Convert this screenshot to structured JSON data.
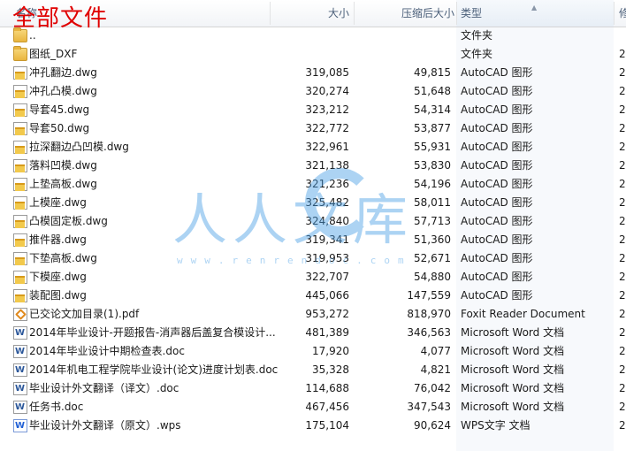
{
  "overlay_title": "全部文件",
  "columns": {
    "name": "名称",
    "size": "大小",
    "compressed": "压缩后大小",
    "type": "类型",
    "modified": "修"
  },
  "watermark": {
    "text": "人人文库",
    "url": "www.renrendoc.com"
  },
  "rows": [
    {
      "name": "..",
      "size": "",
      "comp": "",
      "type": "文件夹",
      "mod": "",
      "icon": "folder-icon"
    },
    {
      "name": "图纸_DXF",
      "size": "",
      "comp": "",
      "type": "文件夹",
      "mod": "2",
      "icon": "folder-icon"
    },
    {
      "name": "冲孔翻边.dwg",
      "size": "319,085",
      "comp": "49,815",
      "type": "AutoCAD 图形",
      "mod": "2",
      "icon": "dwg-file-icon"
    },
    {
      "name": "冲孔凸模.dwg",
      "size": "320,274",
      "comp": "51,648",
      "type": "AutoCAD 图形",
      "mod": "2",
      "icon": "dwg-file-icon"
    },
    {
      "name": "导套45.dwg",
      "size": "323,212",
      "comp": "54,314",
      "type": "AutoCAD 图形",
      "mod": "2",
      "icon": "dwg-file-icon"
    },
    {
      "name": "导套50.dwg",
      "size": "322,772",
      "comp": "53,877",
      "type": "AutoCAD 图形",
      "mod": "2",
      "icon": "dwg-file-icon"
    },
    {
      "name": "拉深翻边凸凹模.dwg",
      "size": "322,961",
      "comp": "55,931",
      "type": "AutoCAD 图形",
      "mod": "2",
      "icon": "dwg-file-icon"
    },
    {
      "name": "落料凹模.dwg",
      "size": "321,138",
      "comp": "53,830",
      "type": "AutoCAD 图形",
      "mod": "2",
      "icon": "dwg-file-icon"
    },
    {
      "name": "上垫高板.dwg",
      "size": "321,236",
      "comp": "54,196",
      "type": "AutoCAD 图形",
      "mod": "2",
      "icon": "dwg-file-icon"
    },
    {
      "name": "上模座.dwg",
      "size": "325,482",
      "comp": "58,011",
      "type": "AutoCAD 图形",
      "mod": "2",
      "icon": "dwg-file-icon"
    },
    {
      "name": "凸模固定板.dwg",
      "size": "324,840",
      "comp": "57,713",
      "type": "AutoCAD 图形",
      "mod": "2",
      "icon": "dwg-file-icon"
    },
    {
      "name": "推件器.dwg",
      "size": "319,341",
      "comp": "51,360",
      "type": "AutoCAD 图形",
      "mod": "2",
      "icon": "dwg-file-icon"
    },
    {
      "name": "下垫高板.dwg",
      "size": "319,953",
      "comp": "52,671",
      "type": "AutoCAD 图形",
      "mod": "2",
      "icon": "dwg-file-icon"
    },
    {
      "name": "下模座.dwg",
      "size": "322,707",
      "comp": "54,880",
      "type": "AutoCAD 图形",
      "mod": "2",
      "icon": "dwg-file-icon"
    },
    {
      "name": "装配图.dwg",
      "size": "445,066",
      "comp": "147,559",
      "type": "AutoCAD 图形",
      "mod": "2",
      "icon": "dwg-file-icon"
    },
    {
      "name": "已交论文加目录(1).pdf",
      "size": "953,272",
      "comp": "818,970",
      "type": "Foxit Reader Document",
      "mod": "2",
      "icon": "pdf-file-icon"
    },
    {
      "name": "2014年毕业设计-开题报告-消声器后盖复合模设计...",
      "size": "481,389",
      "comp": "346,563",
      "type": "Microsoft Word 文档",
      "mod": "2",
      "icon": "word-doc-icon"
    },
    {
      "name": "2014年毕业设计中期检查表.doc",
      "size": "17,920",
      "comp": "4,077",
      "type": "Microsoft Word 文档",
      "mod": "2",
      "icon": "word-doc-icon"
    },
    {
      "name": "2014年机电工程学院毕业设计(论文)进度计划表.doc",
      "size": "35,328",
      "comp": "4,821",
      "type": "Microsoft Word 文档",
      "mod": "2",
      "icon": "word-doc-icon"
    },
    {
      "name": "毕业设计外文翻译（译文）.doc",
      "size": "114,688",
      "comp": "76,042",
      "type": "Microsoft Word 文档",
      "mod": "2",
      "icon": "word-doc-icon"
    },
    {
      "name": "任务书.doc",
      "size": "467,456",
      "comp": "347,543",
      "type": "Microsoft Word 文档",
      "mod": "2",
      "icon": "word-doc-icon"
    },
    {
      "name": "毕业设计外文翻译（原文）.wps",
      "size": "175,104",
      "comp": "90,624",
      "type": "WPS文字 文档",
      "mod": "2",
      "icon": "wps-doc-icon"
    }
  ]
}
